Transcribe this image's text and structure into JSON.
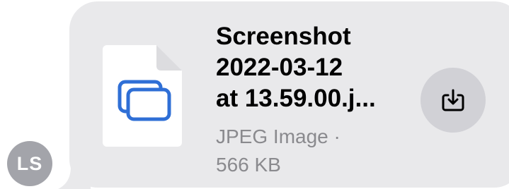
{
  "sender": {
    "initials": "LS"
  },
  "attachment": {
    "file_name": "Screenshot\n2022-03-12\nat 13.59.00.j...",
    "file_type_line": "JPEG Image ·",
    "file_size": "566 KB",
    "icon": "image-file-icon",
    "action_icon": "download-icon"
  },
  "colors": {
    "bubble": "#e9e9eb",
    "avatar": "#a3a4aa",
    "accent": "#2f6fd6",
    "button": "#d1d1d6"
  }
}
